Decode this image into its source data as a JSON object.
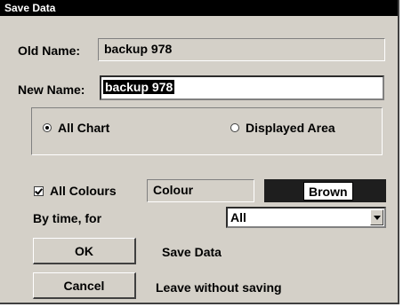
{
  "window": {
    "title": "Save Data"
  },
  "old_name": {
    "label": "Old Name:",
    "value": "backup 978"
  },
  "new_name": {
    "label": "New Name:",
    "value": "backup 978"
  },
  "scope": {
    "options": [
      {
        "label": "All Chart",
        "selected": true
      },
      {
        "label": "Displayed Area",
        "selected": false
      }
    ]
  },
  "colours": {
    "checkbox_label": "All Colours",
    "checked": true,
    "colour_field": "Colour",
    "colour_value": "Brown",
    "colour_value_bg": "#1e1e1e"
  },
  "by_time": {
    "label": "By time, for",
    "selected": "All"
  },
  "buttons": {
    "ok_label": "OK",
    "ok_description": "Save Data",
    "cancel_label": "Cancel",
    "cancel_description": "Leave without saving"
  }
}
